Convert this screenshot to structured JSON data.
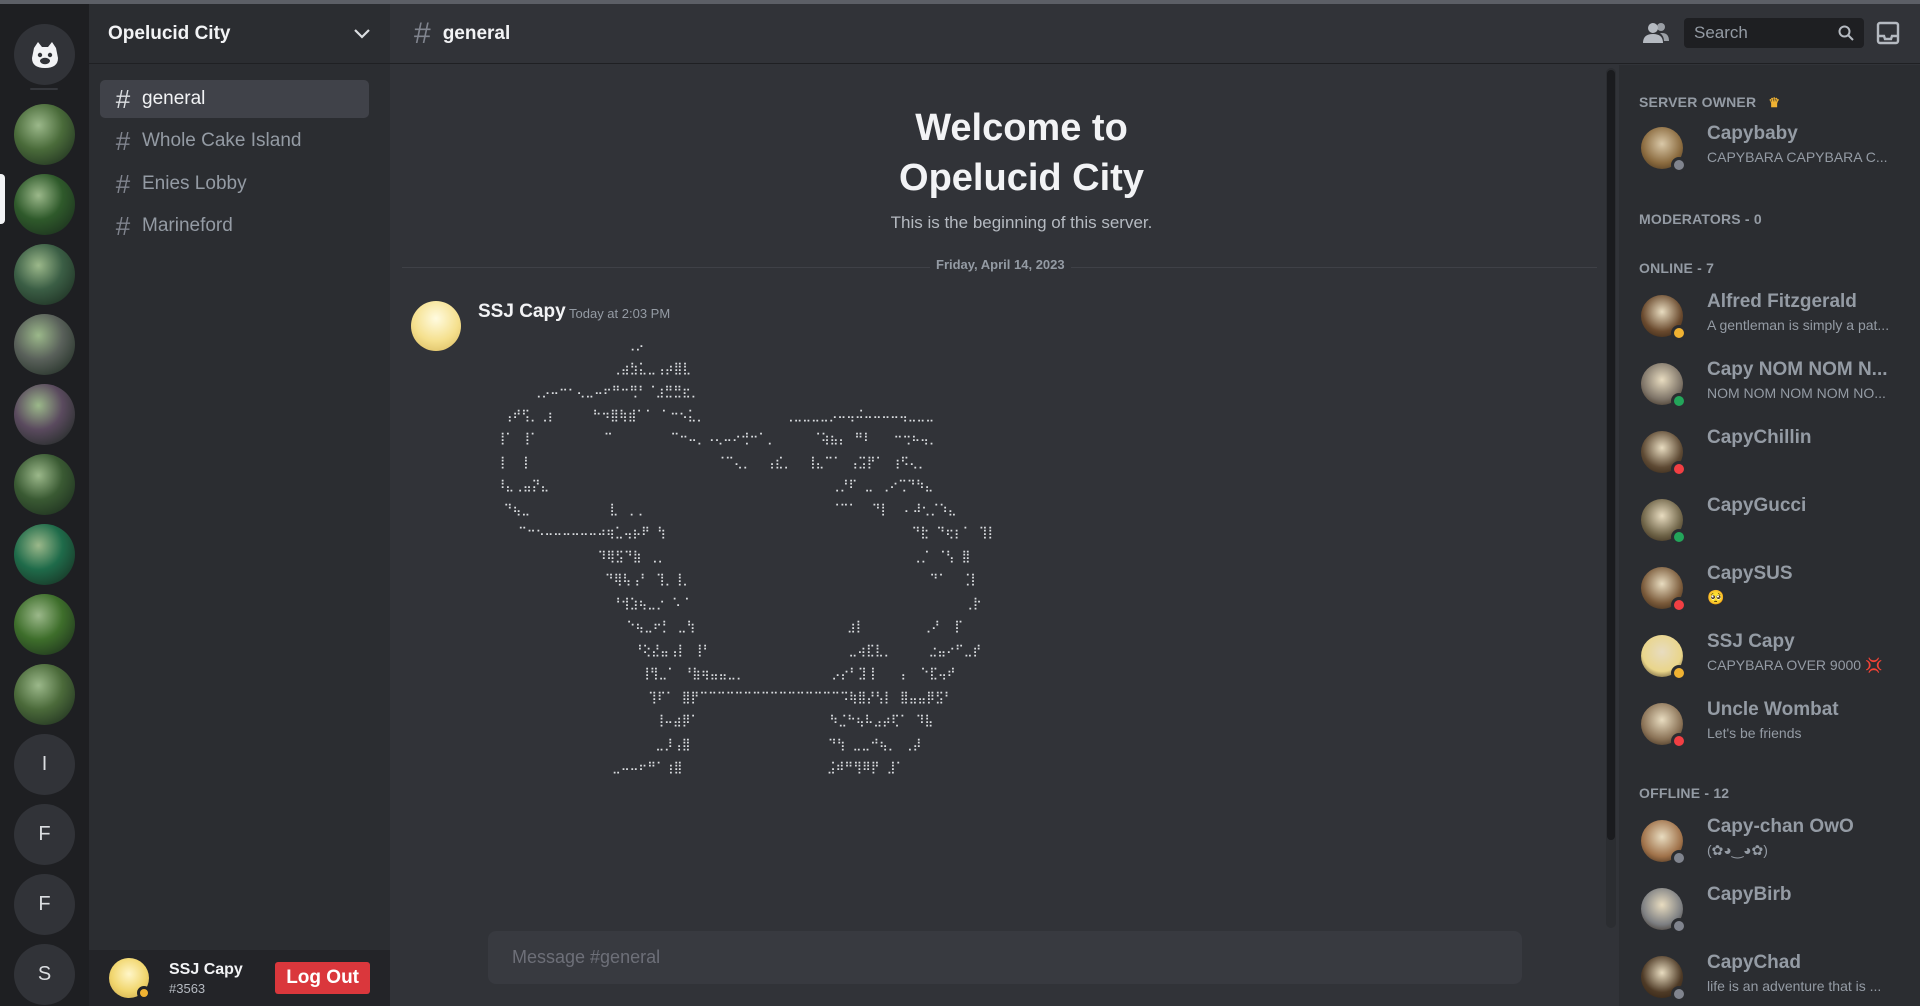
{
  "server": {
    "name": "Opelucid City"
  },
  "rail": {
    "letters": [
      "I",
      "F",
      "F",
      "S"
    ],
    "colors": [
      "#4a6b3a",
      "#2f5a2b",
      "#3b5e45",
      "#59605a",
      "#5a4a5e",
      "#3a5a33",
      "#1f6b4a",
      "#3e6e2b",
      "#4b6a3a"
    ]
  },
  "channels": [
    {
      "label": "general",
      "active": true
    },
    {
      "label": "Whole Cake Island",
      "active": false
    },
    {
      "label": "Enies Lobby",
      "active": false
    },
    {
      "label": "Marineford",
      "active": false
    }
  ],
  "user": {
    "name": "SSJ Capy",
    "tag": "#3563",
    "logout_label": "Log Out"
  },
  "header": {
    "channel": "general",
    "search_placeholder": "Search"
  },
  "welcome": {
    "line1": "Welcome to",
    "line2": "Opelucid City",
    "subtitle": "This is the beginning of this server."
  },
  "date_divider": "Friday, April 14, 2023",
  "message": {
    "author": "SSJ Capy",
    "time": "Today at 2:03 PM",
    "ascii_art": "                    ⢀⡠\n                  ⢀⣴⣳⣅⣀⢠⡴⣿⣇\n       ⢀⡠⠤⠒⠂⢄⣀⠤⠖⠛⠒⢛⠃⠈⣰⣛⣛⣖⡀\n   ⢠⠞⢫⡀⢀⡆     ⠓⠲⣿⢷⣾⠁⠁ ⠁⠒⠢⣅⡀           ⢀⣀⣀⣀⣀⡠⠤⢤⠬⠤⠤⠤⠤⢤⣀⣀⣀\n  ⢸⠁ ⢸⠁         ⠉        ⠉⠒⠤⡀⠠⢄⠤⠔⢚⠒⠁⡀     ⠈⢵⣦⡄ ⠛⠇   ⠒⢒⠦⢤⡀\n  ⢸  ⢸                          ⠈⠉⢄⡀  ⢠⣎⡀  ⢸⣄⠉⠁ ⢠⣩⡟⠁ ⢰⠫⢄⡀\n  ⠸⣄⢀⣤⡝⣄                                       ⢀⡘⠏ ⣀ ⢀⠔⢉⠙⠳⣄\n   ⠙⢦⣀           ⣇ ⢀⢀                          ⠈⠉⠁  ⠙⡇  ⠄⠼⢂⡈⠱⣄\n     ⠉⠒⠢⠤⠤⠤⠤⠤⠤⠴⢶⣁⢤⡦⠟ ⢳                                  ⠙⣗ ⠙⢖⡆⠁ ⢹⡇\n                ⠹⢿⣫⠙⣷ ⢀⡀                                  ⢀⡈ ⠈⢣ ⣿\n                 ⠙⢿⢧⢠⠃ ⢹⡀⢸⡀                                 ⠙⠁  ⢈⡇\n                  ⠘⢺⣱⢦⣀⡐ ⠡⠈                                      ⢀⡗\n                    ⠑⢦⣀⠖⡃ ⣀⢳                     ⣰⡇        ⢀⠜  ⡏\n                     ⠘⢕⣜⣤⢠⡇ ⢸⠃                   ⣀⢴⣏⣇⡀     ⣐⣤⠔⠋⣀⡞\n                      ⢸⢻⣀⠁ ⠘⣷⢶⣤⣤⣀⡀            ⡠⡔⠃⣹⢸   ⢠  ⠑⣏⢤⠞\n                       ⢹⠏⠁ ⣿⡟⠉⠉⠉⠉⠉⠉⠉⠉⠉⠉⠉⠉⠉⠉⠉⠉⠩⢷⣿⡜⢣⡇ ⣿⣤⣤⡿⣫⠃\n                        ⢸⠤⣴⡿⠁                  ⠳⣈⠓⢦⠧⣠⡴⢏⠁ ⠹⣧\n                        ⣀⡸⢠⣿                   ⠙⢳ ⣀⣀⠚⢦⡀ ⢀⡼\n                  ⣀⠤⠤⠖⠛⠁⢰⣿                    ⣨⠾⠛⢻⠿⡟ ⣸⠁"
  },
  "composer": {
    "placeholder": "Message #general"
  },
  "members": {
    "owner_header": "SERVER OWNER",
    "owner": {
      "name": "Capybaby",
      "sub": "CAPYBARA CAPYBARA C...",
      "status": "offline",
      "color": "#8a6a3e"
    },
    "moderators_header": "MODERATORS - 0",
    "online_header": "ONLINE - 7",
    "online": [
      {
        "name": "Alfred Fitzgerald",
        "sub": "A gentleman is simply a pat...",
        "status": "idle",
        "color": "#6a4a2e"
      },
      {
        "name": "Capy NOM NOM N...",
        "sub": "NOM NOM NOM NOM NO...",
        "status": "online",
        "color": "#7e7468"
      },
      {
        "name": "CapyChillin",
        "sub": "",
        "status": "dnd",
        "color": "#5e4a34"
      },
      {
        "name": "CapyGucci",
        "sub": "",
        "status": "online",
        "color": "#6f6448"
      },
      {
        "name": "CapySUS",
        "sub": "🥺",
        "status": "dnd",
        "color": "#7a5a3a"
      },
      {
        "name": "SSJ Capy",
        "sub": "CAPYBARA OVER 9000 💢",
        "status": "idle",
        "color": "#e9d58a"
      },
      {
        "name": "Uncle Wombat",
        "sub": "Let's be friends",
        "status": "dnd",
        "color": "#8a7256"
      }
    ],
    "offline_header": "OFFLINE - 12",
    "offline": [
      {
        "name": "Capy-chan OwO",
        "sub": "(✿◕‿◕✿)",
        "status": "offline",
        "color": "#a0724a"
      },
      {
        "name": "CapyBirb",
        "sub": "",
        "status": "offline",
        "color": "#7d7f82"
      },
      {
        "name": "CapyChad",
        "sub": "life is an adventure that is ...",
        "status": "offline",
        "color": "#4e3a26"
      }
    ]
  }
}
